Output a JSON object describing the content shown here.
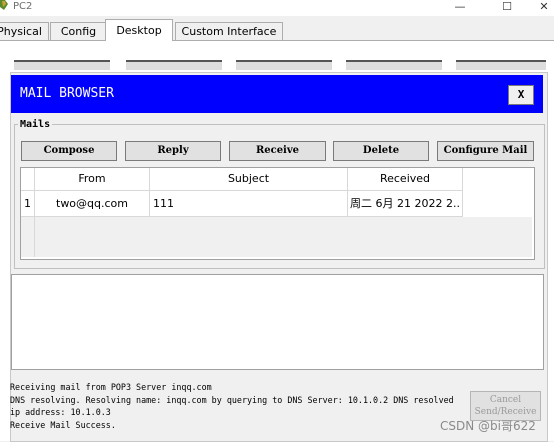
{
  "window": {
    "title": "PC2",
    "minimize_glyph": "—",
    "maximize_glyph": "☐",
    "close_glyph": "✕"
  },
  "tabs": [
    {
      "label": "Physical",
      "active": false
    },
    {
      "label": "Config",
      "active": false
    },
    {
      "label": "Desktop",
      "active": true
    },
    {
      "label": "Custom Interface",
      "active": false
    }
  ],
  "mail_browser": {
    "title": "MAIL BROWSER",
    "close_label": "X",
    "group_label": "Mails",
    "buttons": {
      "compose": "Compose",
      "reply": "Reply",
      "receive": "Receive",
      "delete": "Delete",
      "configure": "Configure Mail"
    },
    "table": {
      "columns": [
        "From",
        "Subject",
        "Received"
      ],
      "rows": [
        {
          "num": "1",
          "from": "two@qq.com",
          "subject": "111",
          "received": "周二 6月 21 2022 2..."
        }
      ]
    }
  },
  "status": {
    "lines": [
      "Receiving mail from POP3 Server inqq.com",
      "DNS resolving. Resolving name: inqq.com by querying to DNS Server: 10.1.0.2  DNS resolved ip address: 10.1.0.3",
      "Receive Mail Success."
    ],
    "cancel_label": "Cancel\nSend/Receive"
  },
  "watermark": "CSDN @bi哥622",
  "colors": {
    "header_blue": "#0000ff",
    "background": "#f0f0f0"
  }
}
